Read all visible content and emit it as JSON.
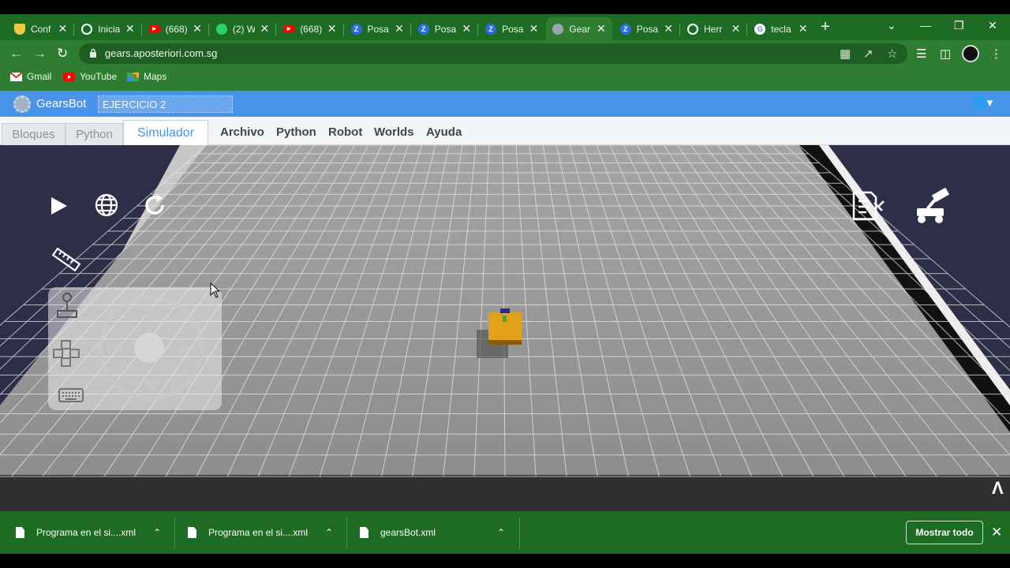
{
  "browser": {
    "tabs": [
      {
        "title": "Conf",
        "icon": "shield-icon",
        "color": "#f2c744"
      },
      {
        "title": "Inicia",
        "icon": "globe-icon",
        "color": "#ffffff"
      },
      {
        "title": "(668)",
        "icon": "youtube-icon",
        "color": "#ff0000"
      },
      {
        "title": "(2) W",
        "icon": "whatsapp-icon",
        "color": "#25d366"
      },
      {
        "title": "(668)",
        "icon": "youtube-icon",
        "color": "#ff0000"
      },
      {
        "title": "Posa",
        "icon": "z-icon",
        "color": "#2d6be4"
      },
      {
        "title": "Posa",
        "icon": "z-icon",
        "color": "#2d6be4"
      },
      {
        "title": "Posa",
        "icon": "z-icon",
        "color": "#2d6be4"
      },
      {
        "title": "Gear",
        "icon": "gear-icon",
        "color": "#9aa6b2"
      },
      {
        "title": "Posa",
        "icon": "z-icon",
        "color": "#2d6be4"
      },
      {
        "title": "Herr",
        "icon": "globe-icon",
        "color": "#ffffff"
      },
      {
        "title": "tecla",
        "icon": "google-icon",
        "color": "#ffffff"
      }
    ],
    "active_tab_index": 8,
    "url": "gears.aposteriori.com.sg",
    "bookmarks": [
      {
        "label": "Gmail",
        "icon": "gmail-icon"
      },
      {
        "label": "YouTube",
        "icon": "youtube-icon"
      },
      {
        "label": "Maps",
        "icon": "maps-icon"
      }
    ]
  },
  "app": {
    "brand": "GearsBot",
    "project_name": "EJERCICIO 2",
    "left_tabs": [
      "Bloques",
      "Python",
      "Simulador"
    ],
    "selected_tab": "Simulador",
    "menu": [
      "Archivo",
      "Python",
      "Robot",
      "Worlds",
      "Ayuda"
    ],
    "accent": "#4a93ea"
  },
  "downloads": {
    "items": [
      "Programa en el si....xml",
      "Programa en el si....xml",
      "gearsBot.xml"
    ],
    "show_all": "Mostrar todo"
  }
}
